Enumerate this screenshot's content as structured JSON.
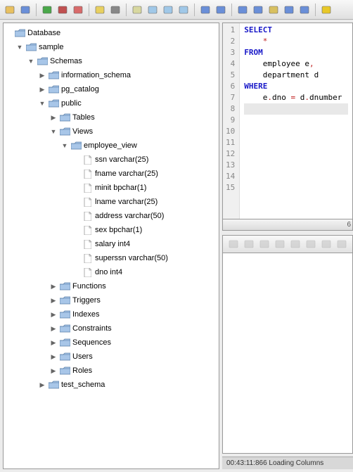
{
  "toolbar": {
    "icons": [
      "folder-open-icon",
      "save-icon",
      "sep",
      "import-green-icon",
      "export-red-icon",
      "copy-db-icon",
      "sep",
      "db-cylinder-icon",
      "wand-icon",
      "sep",
      "doc-icon",
      "doc-lines-icon",
      "doc-refresh-icon",
      "doc-check-icon",
      "sep",
      "stack-blue-icon",
      "stack-lines-icon",
      "sep",
      "rows-icon",
      "rows-alt-icon",
      "rows-highlight-icon",
      "arrow-row-icon",
      "rows-grid-icon",
      "sep",
      "star-icon"
    ]
  },
  "tree": {
    "root": {
      "label": "Database",
      "icon": "folder"
    },
    "sample": {
      "label": "sample",
      "icon": "folder",
      "toggle": "down"
    },
    "schemas": {
      "label": "Schemas",
      "icon": "folder",
      "toggle": "down"
    },
    "info_schema": {
      "label": "information_schema",
      "icon": "folder",
      "toggle": "right"
    },
    "pg_catalog": {
      "label": "pg_catalog",
      "icon": "folder",
      "toggle": "right"
    },
    "public": {
      "label": "public",
      "icon": "folder",
      "toggle": "down"
    },
    "tables": {
      "label": "Tables",
      "icon": "folder",
      "toggle": "right"
    },
    "views": {
      "label": "Views",
      "icon": "folder",
      "toggle": "down"
    },
    "employee_view": {
      "label": "employee_view",
      "icon": "folder",
      "toggle": "down"
    },
    "columns": [
      {
        "label": "ssn varchar(25)"
      },
      {
        "label": "fname varchar(25)"
      },
      {
        "label": "minit bpchar(1)"
      },
      {
        "label": "lname varchar(25)"
      },
      {
        "label": "address varchar(50)"
      },
      {
        "label": "sex bpchar(1)"
      },
      {
        "label": "salary int4"
      },
      {
        "label": "superssn varchar(50)"
      },
      {
        "label": "dno int4"
      }
    ],
    "functions": {
      "label": "Functions",
      "icon": "folder",
      "toggle": "right"
    },
    "triggers": {
      "label": "Triggers",
      "icon": "folder",
      "toggle": "right"
    },
    "indexes": {
      "label": "Indexes",
      "icon": "folder",
      "toggle": "right"
    },
    "constraints": {
      "label": "Constraints",
      "icon": "folder",
      "toggle": "right"
    },
    "sequences": {
      "label": "Sequences",
      "icon": "folder",
      "toggle": "right"
    },
    "users": {
      "label": "Users",
      "icon": "folder",
      "toggle": "right"
    },
    "roles": {
      "label": "Roles",
      "icon": "folder",
      "toggle": "right"
    },
    "test_schema": {
      "label": "test_schema",
      "icon": "folder",
      "toggle": "right"
    }
  },
  "editor": {
    "lines": [
      {
        "n": "1",
        "seg": [
          {
            "t": "SELECT",
            "c": "kw"
          }
        ]
      },
      {
        "n": "2",
        "seg": [
          {
            "t": "    ",
            "c": "txt"
          },
          {
            "t": "*",
            "c": "star"
          }
        ]
      },
      {
        "n": "3",
        "seg": [
          {
            "t": "FROM",
            "c": "kw"
          }
        ]
      },
      {
        "n": "4",
        "seg": [
          {
            "t": "    employee e",
            "c": "txt"
          },
          {
            "t": ",",
            "c": "op"
          }
        ]
      },
      {
        "n": "5",
        "seg": [
          {
            "t": "    department d",
            "c": "txt"
          }
        ]
      },
      {
        "n": "6",
        "seg": [
          {
            "t": "WHERE",
            "c": "kw"
          }
        ]
      },
      {
        "n": "7",
        "seg": [
          {
            "t": "    e",
            "c": "txt"
          },
          {
            "t": ".",
            "c": "op"
          },
          {
            "t": "dno ",
            "c": "txt"
          },
          {
            "t": "=",
            "c": "op"
          },
          {
            "t": " d",
            "c": "txt"
          },
          {
            "t": ".",
            "c": "op"
          },
          {
            "t": "dnumber",
            "c": "txt"
          }
        ]
      },
      {
        "n": "8",
        "seg": [],
        "hl": true
      },
      {
        "n": "9",
        "seg": []
      },
      {
        "n": "10",
        "seg": []
      },
      {
        "n": "11",
        "seg": []
      },
      {
        "n": "12",
        "seg": []
      },
      {
        "n": "13",
        "seg": []
      },
      {
        "n": "14",
        "seg": []
      },
      {
        "n": "15",
        "seg": []
      }
    ],
    "scroll_hint": "6"
  },
  "results_toolbar_icons": [
    "first-icon",
    "prev-icon",
    "rows-icon",
    "next-icon",
    "insert-icon",
    "delete-icon",
    "copy-icon",
    "filter-icon"
  ],
  "status": {
    "text": "00:43:11:866 Loading Columns"
  }
}
